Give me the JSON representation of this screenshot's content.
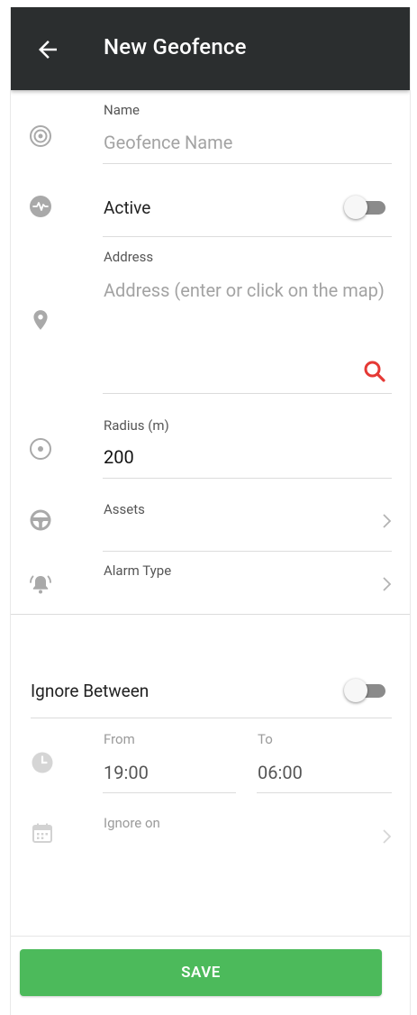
{
  "header": {
    "title": "New Geofence",
    "back_icon": "arrow-left-icon",
    "background": "#2b2e2f"
  },
  "name_field": {
    "label": "Name",
    "placeholder": "Geofence Name",
    "icon": "geofence-target-icon"
  },
  "active": {
    "label": "Active",
    "icon": "activity-pulse-icon",
    "enabled": false
  },
  "address_field": {
    "label": "Address",
    "placeholder": "Address (enter or click on the map)",
    "icon": "map-pin-icon",
    "search_icon": "search-icon",
    "search_color": "#e53935"
  },
  "radius_field": {
    "label": "Radius (m)",
    "value": "200",
    "icon": "radius-dot-icon"
  },
  "assets": {
    "label": "Assets",
    "icon": "steering-wheel-icon"
  },
  "alarm_type": {
    "label": "Alarm Type",
    "icon": "bell-alarm-icon"
  },
  "ignore_between": {
    "label": "Ignore Between",
    "enabled": false
  },
  "time_range": {
    "icon": "clock-icon",
    "from_label": "From",
    "from_value": "19:00",
    "to_label": "To",
    "to_value": "06:00"
  },
  "ignore_on": {
    "label": "Ignore on",
    "icon": "calendar-icon"
  },
  "actions": {
    "save_label": "SAVE",
    "save_color": "#4cba5b"
  }
}
